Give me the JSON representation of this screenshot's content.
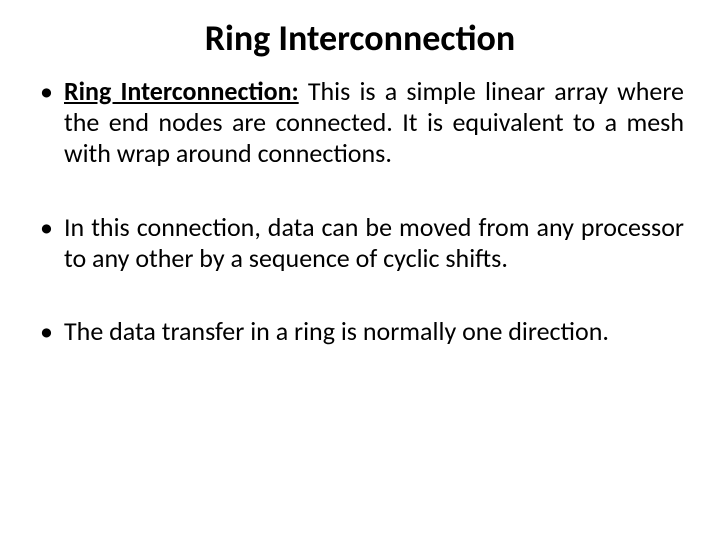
{
  "title": "Ring Interconnection",
  "bullets": [
    {
      "lead": "Ring Interconnection:",
      "rest": " This is a simple linear array where the end nodes are connected. It is equivalent to a mesh with wrap around connections."
    },
    {
      "lead": "",
      "rest": "In this connection, data can be moved from any processor to any other by a sequence of cyclic shifts."
    },
    {
      "lead": "",
      "rest": "The data transfer in a ring is normally one direction."
    }
  ]
}
